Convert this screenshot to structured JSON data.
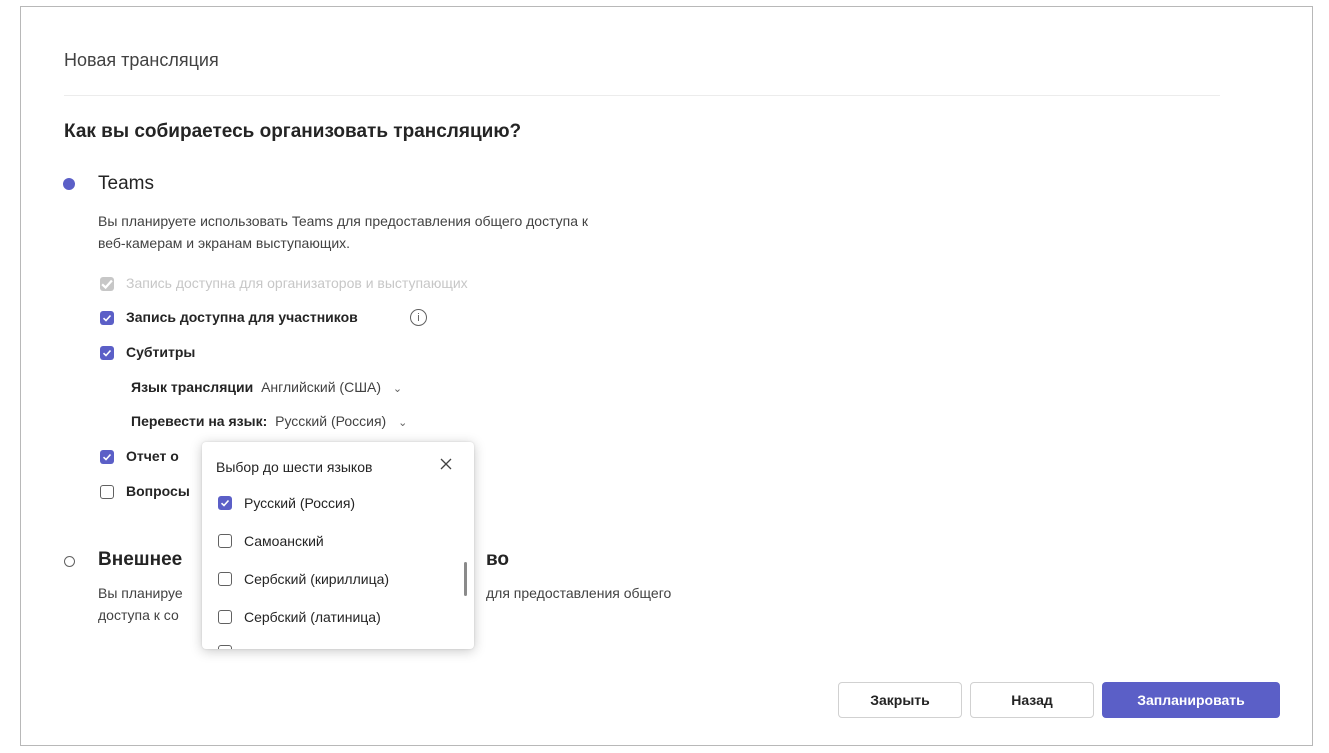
{
  "dialog": {
    "title": "Новая трансляция",
    "question": "Как вы собираетесь организовать трансляцию?"
  },
  "teams_option": {
    "title": "Teams",
    "selected": true,
    "description_line1": "Вы планируете использовать Teams для предоставления общего доступа к",
    "description_line2": "веб-камерам и экранам выступающих."
  },
  "options": {
    "recording_organizers": {
      "label": "Запись доступна для организаторов и выступающих",
      "state": "checked-disabled"
    },
    "recording_attendees": {
      "label": "Запись доступна для участников",
      "state": "checked"
    },
    "captions": {
      "label": "Субтитры",
      "state": "checked"
    },
    "broadcast_language_label": "Язык трансляции",
    "broadcast_language_value": "Английский (США)",
    "translate_label": "Перевести на язык:",
    "translate_value": "Русский (Россия)",
    "report": {
      "label": "Отчет о",
      "state": "checked"
    },
    "qa": {
      "label": "Вопросы",
      "state": "unchecked"
    }
  },
  "external_option": {
    "title": "Внешнее",
    "title_tail": "во",
    "selected": false,
    "description_line1_start": "Вы планируе",
    "description_line1_end": "для предоставления общего",
    "description_line2_start": "доступа к со"
  },
  "language_popup": {
    "title": "Выбор до шести языков",
    "items": [
      {
        "label": "Русский (Россия)",
        "checked": true
      },
      {
        "label": "Самоанский",
        "checked": false
      },
      {
        "label": "Сербский (кириллица)",
        "checked": false
      },
      {
        "label": "Сербский (латиница)",
        "checked": false
      }
    ]
  },
  "buttons": {
    "close": "Закрыть",
    "back": "Назад",
    "schedule": "Запланировать"
  },
  "colors": {
    "accent": "#5b5fc7",
    "disabled": "#c7c7c7"
  }
}
